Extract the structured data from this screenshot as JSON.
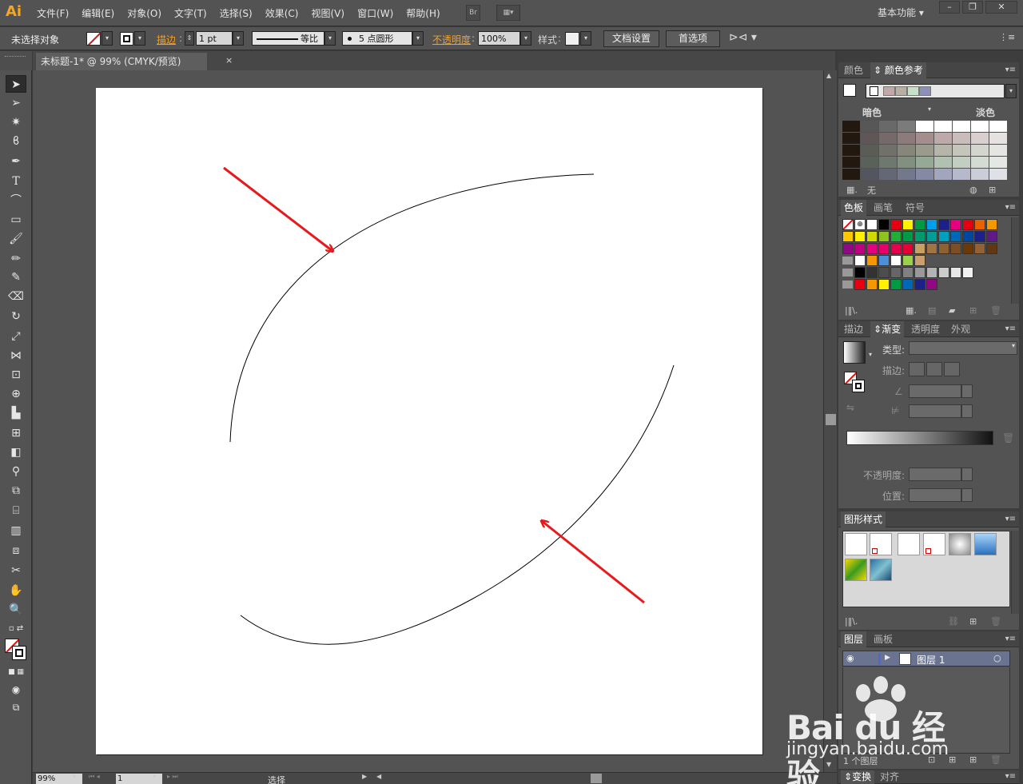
{
  "app": {
    "logo": "Ai"
  },
  "menubar": {
    "items": [
      "文件(F)",
      "编辑(E)",
      "对象(O)",
      "文字(T)",
      "选择(S)",
      "效果(C)",
      "视图(V)",
      "窗口(W)",
      "帮助(H)"
    ],
    "bridge_label": "Br",
    "workspace": "基本功能",
    "window_buttons": [
      "–",
      "❐",
      "✕"
    ]
  },
  "controlbar": {
    "selection_status": "未选择对象",
    "stroke_label": "描边",
    "stroke_weight": "1 pt",
    "profile_label": "等比",
    "brush_label": "5 点圆形",
    "opacity_label": "不透明度",
    "opacity_value": "100%",
    "style_label": "样式",
    "doc_setup_button": "文档设置",
    "prefs_button": "首选项"
  },
  "document": {
    "tab_title": "未标题-1* @ 99% (CMYK/预览)",
    "close_glyph": "×"
  },
  "statusbar": {
    "zoom": "99%",
    "page": "1",
    "status_text": "选择"
  },
  "panels": {
    "color": {
      "tabs": [
        "颜色",
        "颜色参考"
      ],
      "active_tab": 1,
      "dark_label": "暗色",
      "light_label": "淡色",
      "none_label": "无",
      "harmony_colors": [
        "#c0a8a8",
        "#b8b0a0",
        "#c8e0c8",
        "#8c90b8"
      ]
    },
    "swatches": {
      "tabs": [
        "色板",
        "画笔",
        "符号"
      ],
      "active_tab": 0
    },
    "gradient": {
      "tabs": [
        "描边",
        "渐变",
        "透明度",
        "外观"
      ],
      "active_tab": 1,
      "type_label": "类型",
      "stroke_label": "描边",
      "opacity_label": "不透明度",
      "position_label": "位置"
    },
    "graphic_styles": {
      "tabs": [
        "图形样式"
      ],
      "active_tab": 0
    },
    "layers": {
      "tabs": [
        "图层",
        "画板"
      ],
      "active_tab": 0,
      "layer_name": "图层 1",
      "layer_color": "#4a6bd0",
      "footer": "1 个图层"
    },
    "transform": {
      "tabs": [
        "变换",
        "对齐"
      ],
      "active_tab": 0
    }
  },
  "artwork": {
    "stroke_color": "#000000",
    "arrow_color": "#e8191c"
  },
  "watermark": {
    "text": "Bai du 经验",
    "url": "jingyan.baidu.com"
  }
}
